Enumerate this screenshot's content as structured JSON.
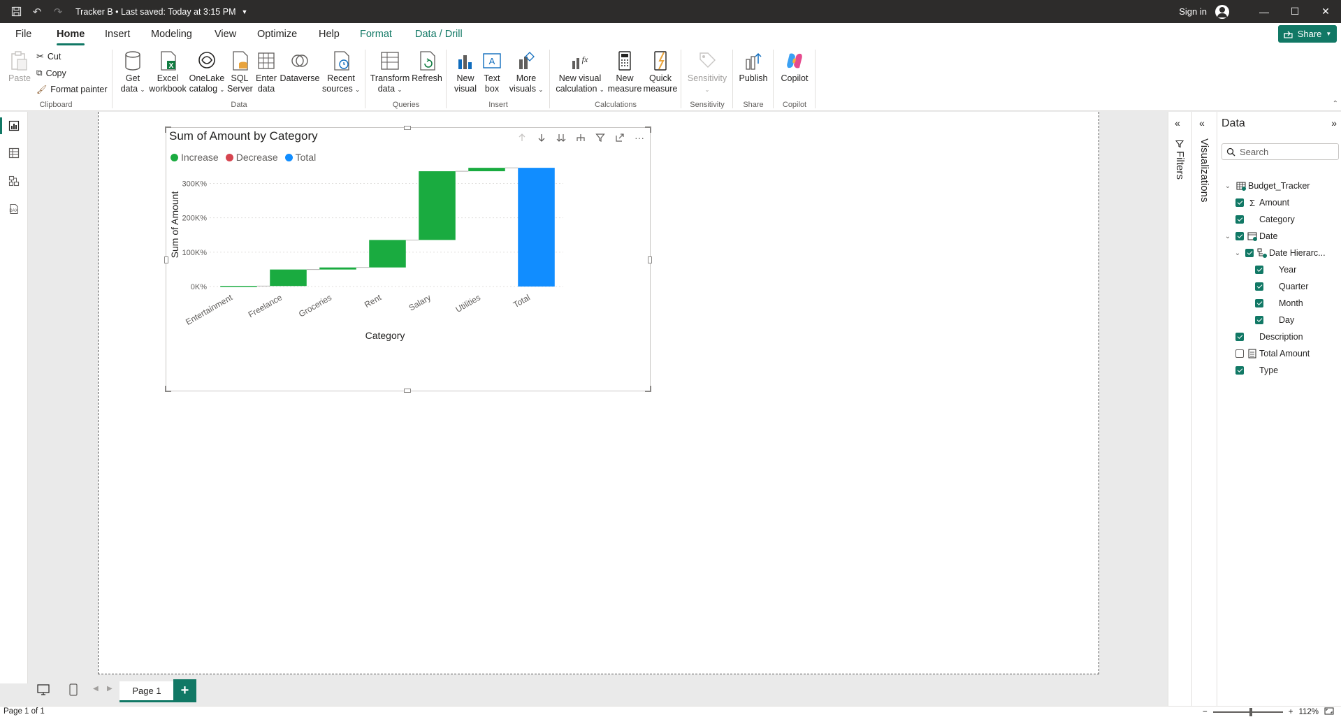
{
  "titlebar": {
    "title": "Tracker B • Last saved: Today at 3:15 PM",
    "signin": "Sign in"
  },
  "menu": {
    "tabs": [
      "File",
      "Home",
      "Insert",
      "Modeling",
      "View",
      "Optimize",
      "Help",
      "Format",
      "Data / Drill"
    ],
    "active": "Home",
    "share": "Share"
  },
  "ribbon": {
    "clipboard": {
      "label": "Clipboard",
      "paste": "Paste",
      "cut": "Cut",
      "copy": "Copy",
      "format_painter": "Format painter"
    },
    "data": {
      "label": "Data",
      "get_data": [
        "Get",
        "data"
      ],
      "excel": [
        "Excel",
        "workbook"
      ],
      "onelake": [
        "OneLake",
        "catalog"
      ],
      "sql": [
        "SQL",
        "Server"
      ],
      "enter": [
        "Enter",
        "data"
      ],
      "dataverse": "Dataverse",
      "recent": [
        "Recent",
        "sources"
      ]
    },
    "queries": {
      "label": "Queries",
      "transform": [
        "Transform",
        "data"
      ],
      "refresh": "Refresh"
    },
    "insert": {
      "label": "Insert",
      "new_visual": [
        "New",
        "visual"
      ],
      "text_box": [
        "Text",
        "box"
      ],
      "more_visuals": [
        "More",
        "visuals"
      ]
    },
    "calculations": {
      "label": "Calculations",
      "new_visual_calc": [
        "New visual",
        "calculation"
      ],
      "new_measure": [
        "New",
        "measure"
      ],
      "quick_measure": [
        "Quick",
        "measure"
      ]
    },
    "sensitivity": {
      "label": "Sensitivity",
      "btn": "Sensitivity"
    },
    "share": {
      "label": "Share",
      "publish": "Publish"
    },
    "copilot": {
      "label": "Copilot",
      "btn": "Copilot"
    }
  },
  "visual": {
    "title": "Sum of Amount by Category",
    "legend": [
      {
        "label": "Increase",
        "color": "#1aab40"
      },
      {
        "label": "Decrease",
        "color": "#d64550"
      },
      {
        "label": "Total",
        "color": "#118dff"
      }
    ]
  },
  "chart_data": {
    "type": "waterfall",
    "title": "Sum of Amount by Category",
    "xlabel": "Category",
    "ylabel": "Sum of Amount",
    "categories": [
      "Entertainment",
      "Freelance",
      "Groceries",
      "Rent",
      "Salary",
      "Utilities",
      "Total"
    ],
    "values": [
      1500,
      48000,
      6000,
      80000,
      200000,
      10000,
      345500
    ],
    "kinds": [
      "increase",
      "increase",
      "increase",
      "increase",
      "increase",
      "increase",
      "total"
    ],
    "yticks": [
      0,
      100000,
      200000,
      300000
    ],
    "ytick_labels": [
      "0K%",
      "100K%",
      "200K%",
      "300K%"
    ],
    "ylim": [
      0,
      360000
    ],
    "grid": true,
    "legend_position": "top-left"
  },
  "pages": {
    "tab": "Page 1",
    "add": "+"
  },
  "status": {
    "page": "Page 1 of 1",
    "zoom": "112%"
  },
  "panes": {
    "filters": "Filters",
    "visualizations": "Visualizations",
    "data": {
      "title": "Data",
      "search_placeholder": "Search",
      "tree": [
        {
          "label": "Budget_Tracker",
          "type": "table",
          "level": 0,
          "checked": null,
          "expanded": true
        },
        {
          "label": "Amount",
          "type": "sum",
          "level": 1,
          "checked": true
        },
        {
          "label": "Category",
          "type": "field",
          "level": 1,
          "checked": true
        },
        {
          "label": "Date",
          "type": "date",
          "level": 1,
          "checked": true,
          "expanded": true
        },
        {
          "label": "Date Hierarc...",
          "type": "hierarchy",
          "level": 2,
          "checked": true,
          "expanded": true
        },
        {
          "label": "Year",
          "type": "field",
          "level": 3,
          "checked": true
        },
        {
          "label": "Quarter",
          "type": "field",
          "level": 3,
          "checked": true
        },
        {
          "label": "Month",
          "type": "field",
          "level": 3,
          "checked": true
        },
        {
          "label": "Day",
          "type": "field",
          "level": 3,
          "checked": true
        },
        {
          "label": "Description",
          "type": "field",
          "level": 1,
          "checked": true
        },
        {
          "label": "Total Amount",
          "type": "calc",
          "level": 1,
          "checked": false
        },
        {
          "label": "Type",
          "type": "field",
          "level": 1,
          "checked": true
        }
      ]
    }
  }
}
